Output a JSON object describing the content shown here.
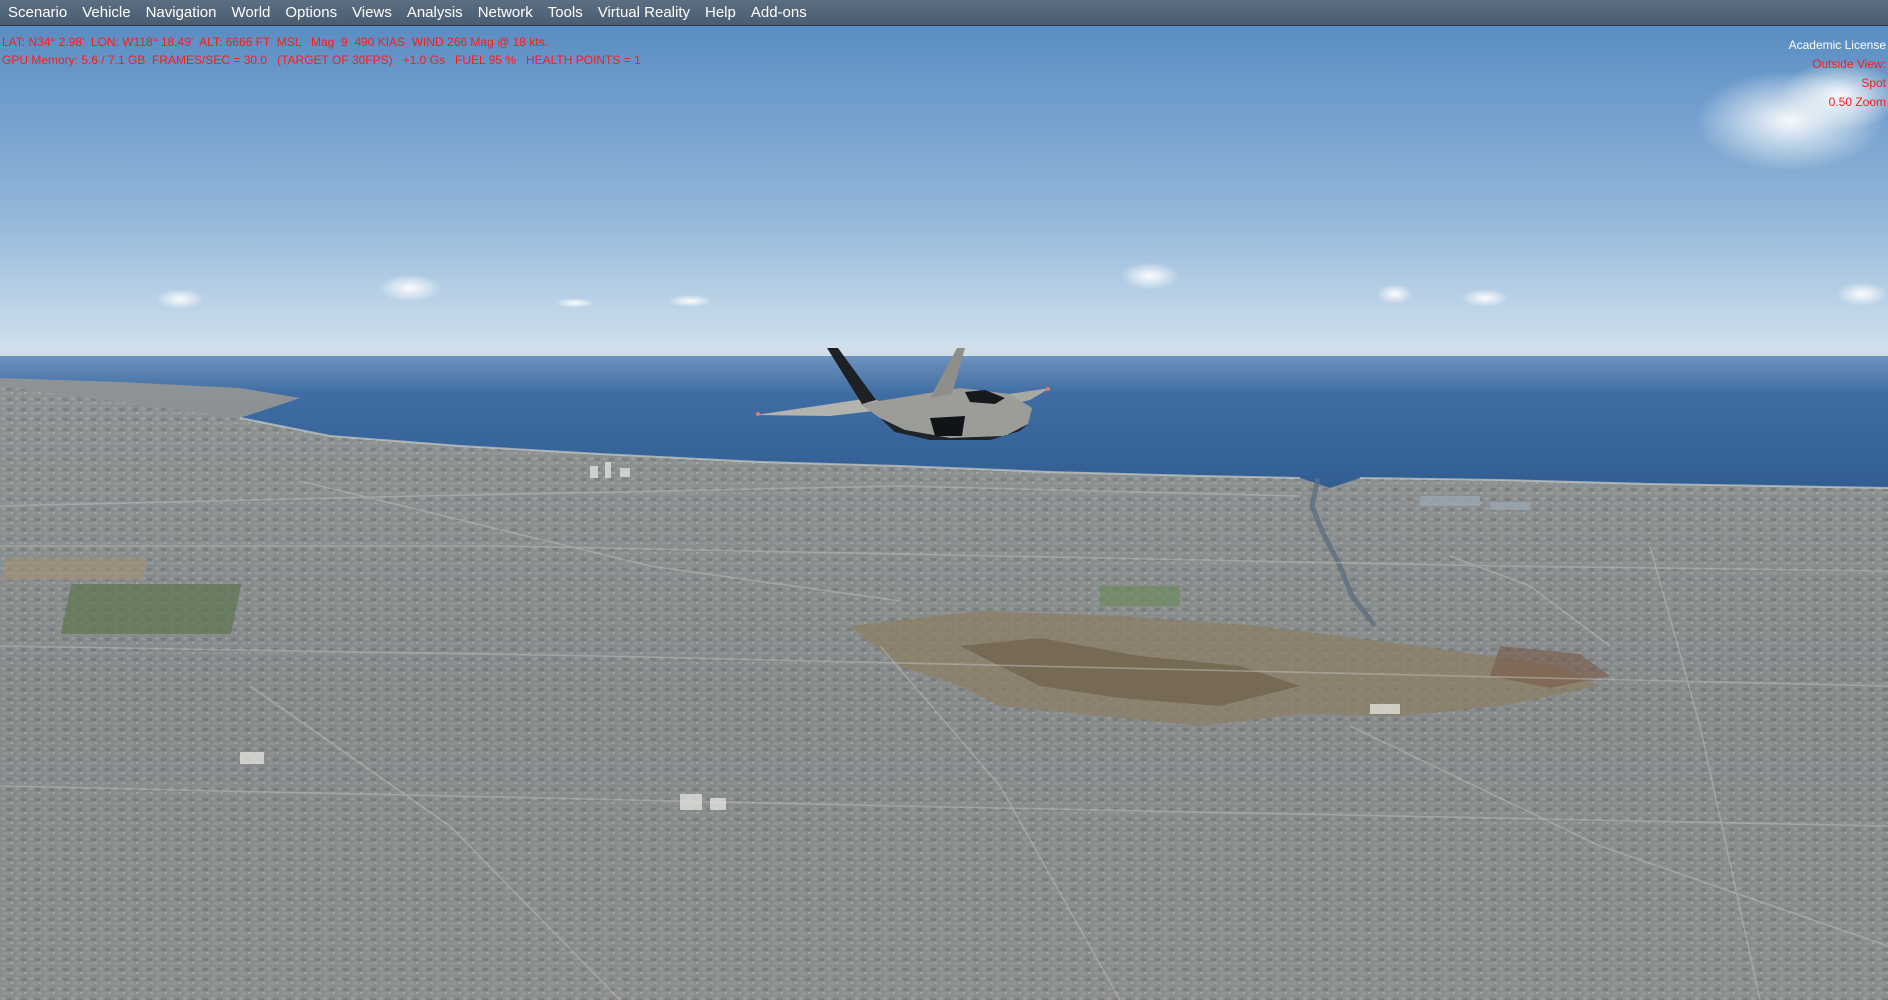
{
  "menu": {
    "items": [
      {
        "label": "Scenario"
      },
      {
        "label": "Vehicle"
      },
      {
        "label": "Navigation"
      },
      {
        "label": "World"
      },
      {
        "label": "Options"
      },
      {
        "label": "Views"
      },
      {
        "label": "Analysis"
      },
      {
        "label": "Network"
      },
      {
        "label": "Tools"
      },
      {
        "label": "Virtual Reality"
      },
      {
        "label": "Help"
      },
      {
        "label": "Add-ons"
      }
    ]
  },
  "hud": {
    "line1": "LAT: N34° 2.98'  LON: W118° 18.49'  ALT: 6666 FT  MSL   Mag  9  490 KIAS  WIND 266 Mag @ 18 kts.",
    "line2": "GPU Memory: 5.6 / 7.1 GB  FRAMES/SEC = 30.0   (TARGET OF 30FPS)   +1.0 Gs   FUEL 95 %   HEALTH POINTS = 1",
    "license": "Academic License",
    "view_label": "Outside View:",
    "view_mode": "Spot",
    "zoom": "0.50 Zoom"
  },
  "colors": {
    "menubar": "#4f6276",
    "hud_text": "#ff1a1a",
    "sky_top": "#5d8fc4",
    "sky_horizon": "#c9dceb",
    "ocean": "#3d6aa0",
    "land": "#8a8f90"
  },
  "icons": {
    "aircraft": "fighter-jet-icon"
  }
}
